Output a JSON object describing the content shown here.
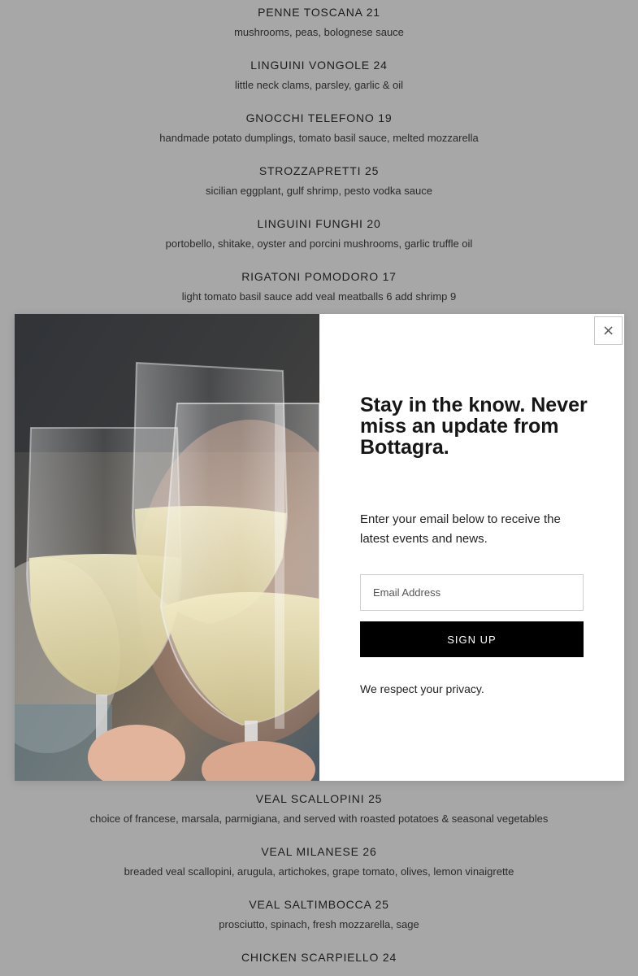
{
  "menu_top": [
    {
      "title": "PENNE TOSCANA 21",
      "desc": "mushrooms, peas, bolognese sauce"
    },
    {
      "title": "LINGUINI VONGOLE 24",
      "desc": "little neck clams, parsley, garlic & oil"
    },
    {
      "title": "GNOCCHI TELEFONO 19",
      "desc": "handmade potato dumplings, tomato basil sauce, melted mozzarella"
    },
    {
      "title": "STROZZAPRETTI 25",
      "desc": "sicilian eggplant, gulf shrimp, pesto vodka sauce"
    },
    {
      "title": "LINGUINI FUNGHI 20",
      "desc": "portobello, shitake, oyster and porcini mushrooms, garlic truffle oil"
    },
    {
      "title": "RIGATONI POMODORO 17",
      "desc": "light tomato basil sauce add veal meatballs 6 add shrimp 9"
    }
  ],
  "menu_bottom": [
    {
      "title": "VEAL SCALLOPINI 25",
      "desc": "choice of francese, marsala, parmigiana, and served with roasted potatoes & seasonal vegetables"
    },
    {
      "title": "VEAL MILANESE 26",
      "desc": "breaded veal scallopini, arugula, artichokes, grape tomato, olives, lemon vinaigrette"
    },
    {
      "title": "VEAL SALTIMBOCCA 25",
      "desc": "prosciutto, spinach, fresh mozzarella, sage"
    },
    {
      "title": "CHICKEN SCARPIELLO 24",
      "desc": ""
    }
  ],
  "popup": {
    "close_symbol": "×",
    "heading": "Stay in the know. Never miss an update from Bottagra.",
    "body": "Enter your email below to receive the latest events and news.",
    "email_placeholder": "Email Address",
    "signup_label": "SIGN UP",
    "privacy": "We respect your privacy.",
    "image_icon": "wine-glasses-toast-photo"
  },
  "colors": {
    "overlay_background": "#a7a7a7",
    "button_background": "#000000",
    "modal_background": "#ffffff"
  }
}
